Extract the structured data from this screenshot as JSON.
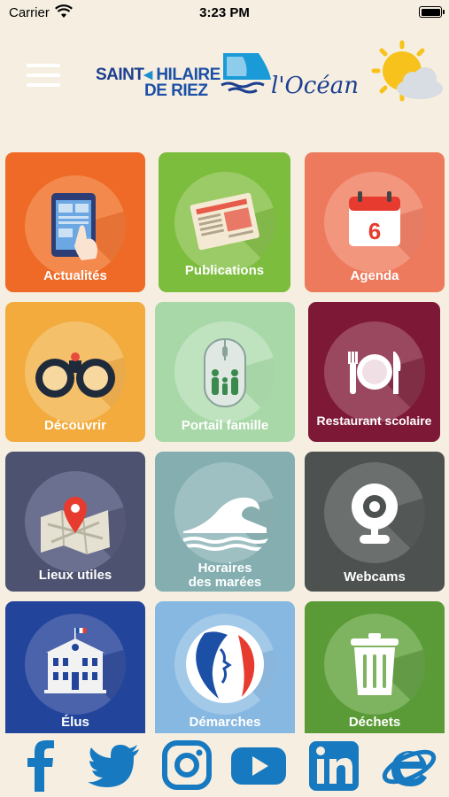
{
  "status_bar": {
    "carrier": "Carrier",
    "time": "3:23 PM"
  },
  "header": {
    "logo_line1_a": "SAINT",
    "logo_line1_b": "HILAIRE",
    "logo_line2": "DE RIEZ",
    "logo_ocean": "l'Océan"
  },
  "tiles": [
    {
      "label": "Actualités",
      "color": "#ee6a26",
      "icon": "tablet-touch-icon"
    },
    {
      "label": "Publications",
      "color": "#7cbd3d",
      "icon": "newspaper-icon"
    },
    {
      "label": "Agenda",
      "color": "#ee7a5d",
      "icon": "calendar-icon"
    },
    {
      "label": "Découvrir",
      "color": "#f2ab3c",
      "icon": "binoculars-icon"
    },
    {
      "label": "Portail famille",
      "color": "#a9d8a8",
      "icon": "mouse-family-icon"
    },
    {
      "label": "Restaurant scolaire",
      "color": "#7d1837",
      "icon": "plate-cutlery-icon"
    },
    {
      "label": "Lieux utiles",
      "color": "#4d5270",
      "icon": "map-pin-icon"
    },
    {
      "label_line1": "Horaires",
      "label_line2": "des marées",
      "color": "#84aeb0",
      "icon": "wave-icon"
    },
    {
      "label": "Webcams",
      "color": "#4d5150",
      "icon": "webcam-icon"
    },
    {
      "label": "Élus",
      "color": "#22449a",
      "icon": "town-hall-icon"
    },
    {
      "label": "Démarches",
      "color": "#87b8e1",
      "icon": "marianne-icon"
    },
    {
      "label": "Déchets",
      "color": "#5a9b37",
      "icon": "trash-icon"
    }
  ],
  "social": [
    "facebook-icon",
    "twitter-icon",
    "instagram-icon",
    "youtube-icon",
    "linkedin-icon",
    "internet-explorer-icon"
  ],
  "colors": {
    "background": "#f6efe1",
    "brand_blue": "#1c3f8f",
    "social_blue": "#1779c0"
  }
}
